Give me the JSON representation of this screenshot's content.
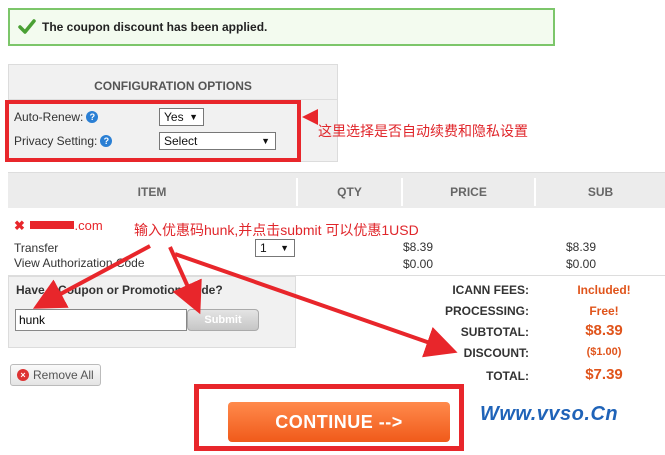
{
  "success": {
    "message": "The coupon discount has been applied."
  },
  "config": {
    "header": "CONFIGURATION OPTIONS",
    "auto_renew_label": "Auto-Renew:",
    "auto_renew_value": "Yes",
    "privacy_label": "Privacy Setting:",
    "privacy_value": "Select",
    "help_glyph": "?"
  },
  "annotations": {
    "config_note": "这里选择是否自动续费和隐私设置",
    "coupon_note": "输入优惠码hunk,并点击submit 可以优惠1USD"
  },
  "table": {
    "headers": [
      "ITEM",
      "QTY",
      "PRICE",
      "SUB"
    ],
    "item": {
      "domain_suffix": ".com",
      "type": "Transfer",
      "auth": "View Authorization Code",
      "qty": "1",
      "price_main": "$8.39",
      "price_auth": "$0.00",
      "sub_main": "$8.39",
      "sub_auth": "$0.00"
    }
  },
  "coupon": {
    "title": "Have a Coupon or Promotion Code?",
    "value": "hunk",
    "submit_label": "Submit"
  },
  "totals": {
    "icann_label": "ICANN FEES:",
    "icann_value": "Included!",
    "processing_label": "PROCESSING:",
    "processing_value": "Free!",
    "subtotal_label": "SUBTOTAL:",
    "subtotal_value": "$8.39",
    "discount_label": "DISCOUNT:",
    "discount_value": "($1.00)",
    "total_label": "TOTAL:",
    "total_value": "$7.39"
  },
  "actions": {
    "remove_all": "Remove All",
    "continue": "CONTINUE -->"
  },
  "watermark": "Www.vvso.Cn",
  "colors": {
    "accent": "#e0541b",
    "annotation_red": "#e8262b",
    "success_border": "#7cc66a"
  }
}
